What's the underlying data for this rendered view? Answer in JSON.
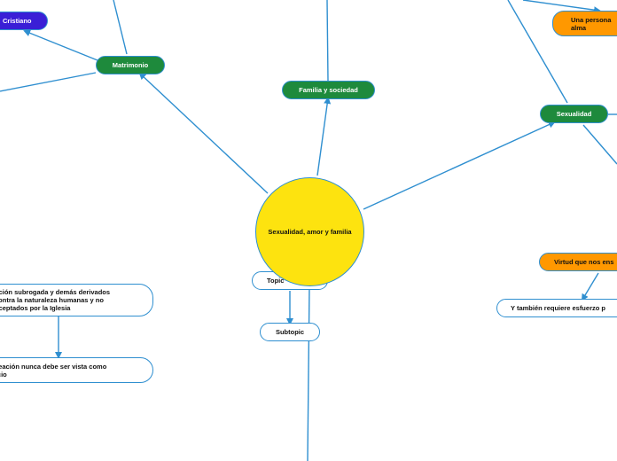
{
  "central": {
    "label": "Sexualidad, amor y familia"
  },
  "main_topics": {
    "matrimonio": "Matrimonio",
    "familia": "Familia y sociedad",
    "sexualidad": "Sexualidad"
  },
  "subtopics": {
    "cristiano": "Cristiano",
    "una_persona": "Una persona\nalma",
    "virtud": "Virtud que nos ens",
    "tambien": "Y también requiere esfuerzo p",
    "gestacion": "gestación subrogada y demás derivados\nvan contra la naturaleza humanas y no\nson aceptados por la Iglesia",
    "procreacion": "procreación nunca debe ser vista como\nnegocio",
    "topic": "Topic",
    "subtopic": "Subtopic"
  },
  "colors": {
    "connector": "#2f8fd0",
    "central": "#fde30f",
    "main_topic": "#1e8a3c",
    "cristiano": "#3a1fd6",
    "accent_orange": "#ff9800"
  }
}
